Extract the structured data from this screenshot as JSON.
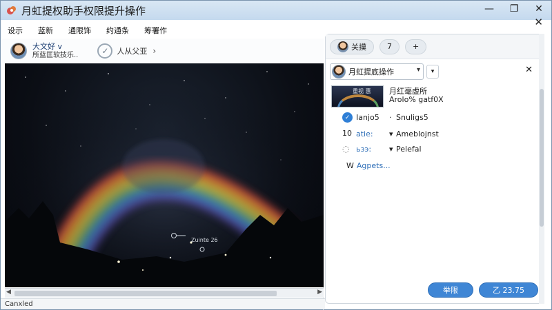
{
  "window": {
    "title": "月虹提权助手权限提升操作",
    "minimize": "—",
    "maximize": "❐",
    "close": "✕",
    "inner_close": "✕"
  },
  "menu": [
    "设示",
    "蓝新",
    "通限饰",
    "约通条",
    "筹署作"
  ],
  "left": {
    "user_name": "大文好 v",
    "user_sub": "所蓝匡软技乐..",
    "check_label": "人从父亚",
    "image_caption": "Zuinte 26",
    "status": "Canxled"
  },
  "panel": {
    "tab_label": "关摸",
    "tab_num": "7",
    "tab_plus": "+",
    "selector_label": "月虹提底操作",
    "thumb_overlay": "重视 惠",
    "thumb_title": "月红毫虚所",
    "thumb_sub": "Arolo% gatf0X",
    "rows": [
      {
        "marker": "✓",
        "left": "Ianjo5",
        "sep": "·",
        "right": "Snuligs5"
      },
      {
        "marker": "10",
        "left": "atie:",
        "sep": "▾",
        "right": "Ameblojnst"
      },
      {
        "marker": "◌",
        "left": "ьзэ:",
        "sep": "▾",
        "right": "Pelefal"
      }
    ],
    "more_prefix": "W",
    "more_link": "Agpets...",
    "btn_cancel": "举限",
    "btn_ok": "乙 23.75"
  },
  "colors": {
    "accent": "#3f86d5",
    "title_bg": "#c4d9ee"
  }
}
